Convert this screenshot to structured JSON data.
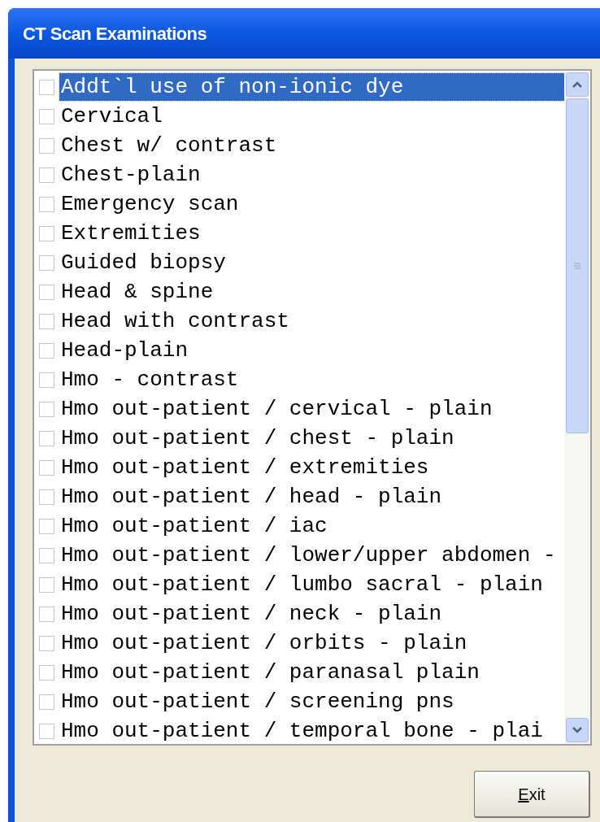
{
  "window": {
    "title": "CT Scan Examinations"
  },
  "items": [
    {
      "label": "Addt`l use of non-ionic dye",
      "checked": false,
      "selected": true
    },
    {
      "label": "Cervical",
      "checked": false,
      "selected": false
    },
    {
      "label": "Chest w/ contrast",
      "checked": false,
      "selected": false
    },
    {
      "label": "Chest-plain",
      "checked": false,
      "selected": false
    },
    {
      "label": "Emergency scan",
      "checked": false,
      "selected": false
    },
    {
      "label": "Extremities",
      "checked": false,
      "selected": false
    },
    {
      "label": "Guided biopsy",
      "checked": false,
      "selected": false
    },
    {
      "label": "Head & spine",
      "checked": false,
      "selected": false
    },
    {
      "label": "Head with contrast",
      "checked": false,
      "selected": false
    },
    {
      "label": "Head-plain",
      "checked": false,
      "selected": false
    },
    {
      "label": "Hmo - contrast",
      "checked": false,
      "selected": false
    },
    {
      "label": "Hmo out-patient / cervical - plain",
      "checked": false,
      "selected": false
    },
    {
      "label": "Hmo out-patient / chest - plain",
      "checked": false,
      "selected": false
    },
    {
      "label": "Hmo out-patient / extremities",
      "checked": false,
      "selected": false
    },
    {
      "label": "Hmo out-patient / head - plain",
      "checked": false,
      "selected": false
    },
    {
      "label": "Hmo out-patient / iac",
      "checked": false,
      "selected": false
    },
    {
      "label": "Hmo out-patient / lower/upper abdomen -",
      "checked": false,
      "selected": false
    },
    {
      "label": "Hmo out-patient / lumbo sacral - plain",
      "checked": false,
      "selected": false
    },
    {
      "label": "Hmo out-patient / neck - plain",
      "checked": false,
      "selected": false
    },
    {
      "label": "Hmo out-patient / orbits - plain",
      "checked": false,
      "selected": false
    },
    {
      "label": "Hmo out-patient / paranasal plain",
      "checked": false,
      "selected": false
    },
    {
      "label": "Hmo out-patient / screening pns",
      "checked": false,
      "selected": false
    },
    {
      "label": "Hmo out-patient / temporal bone - plai",
      "checked": false,
      "selected": false
    }
  ],
  "buttons": [
    {
      "label": "Exit"
    }
  ]
}
